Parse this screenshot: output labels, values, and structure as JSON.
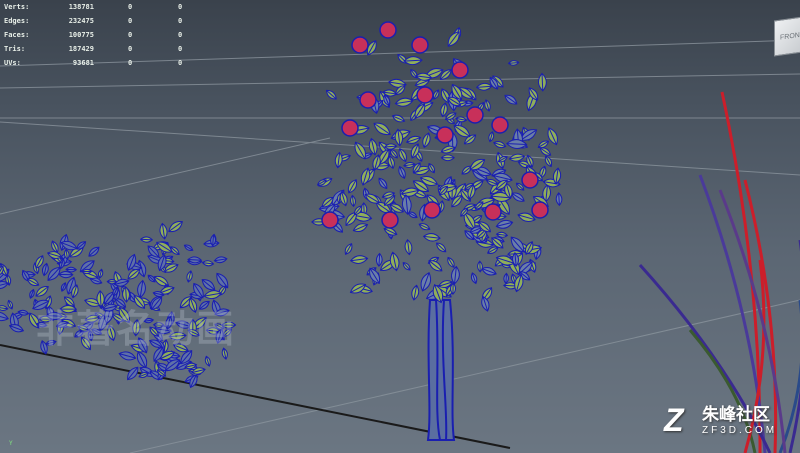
{
  "hud": {
    "rows": [
      {
        "label": "Verts:",
        "v1": "138781",
        "v2": "0",
        "v3": "0"
      },
      {
        "label": "Edges:",
        "v1": "232475",
        "v2": "0",
        "v3": "0"
      },
      {
        "label": "Faces:",
        "v1": "100775",
        "v2": "0",
        "v3": "0"
      },
      {
        "label": "Tris:",
        "v1": "187429",
        "v2": "0",
        "v3": "0"
      },
      {
        "label": "UVs:",
        "v1": "93681",
        "v2": "0",
        "v3": "0"
      }
    ]
  },
  "viewcube": {
    "label": "FRONT"
  },
  "axis": {
    "label": "Y"
  },
  "watermarks": {
    "left": "非著名动画",
    "right_logo": "Z",
    "right_cn": "朱峰社区",
    "right_en": "ZF3D.COM"
  },
  "colors": {
    "wire": "#1a1fb0",
    "leaf_fill": "#8fae5a",
    "flower": "#c8305a",
    "grid": "#8a939c",
    "grid_dark": "#1a1a1a",
    "stem_red": "#cc1e2a"
  }
}
